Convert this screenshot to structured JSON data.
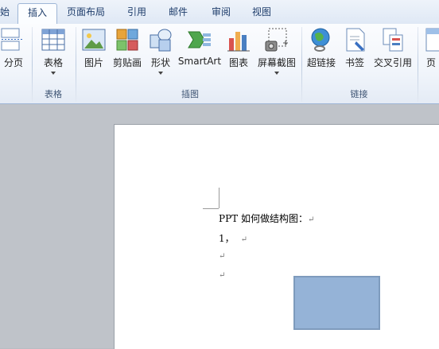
{
  "tabs": {
    "partial_left": "始",
    "insert": "插入",
    "page_layout": "页面布局",
    "references": "引用",
    "mailings": "邮件",
    "review": "审阅",
    "view": "视图"
  },
  "ribbon": {
    "page_break": "分页",
    "table": "表格",
    "picture": "图片",
    "clip_art": "剪贴画",
    "shapes": "形状",
    "smartart": "SmartArt",
    "chart": "图表",
    "screenshot": "屏幕截图",
    "hyperlink": "超链接",
    "bookmark": "书签",
    "cross_reference": "交叉引用",
    "header_partial": "页",
    "group_tables": "表格",
    "group_illustrations": "插图",
    "group_links": "链接"
  },
  "document": {
    "line1": "PPT 如何做结构图：",
    "line2": "1，",
    "paragraph_mark": "↵"
  },
  "colors": {
    "shape_fill": "#95b3d7",
    "shape_border": "#7e9bbd",
    "accent": "#1e3d6b"
  }
}
